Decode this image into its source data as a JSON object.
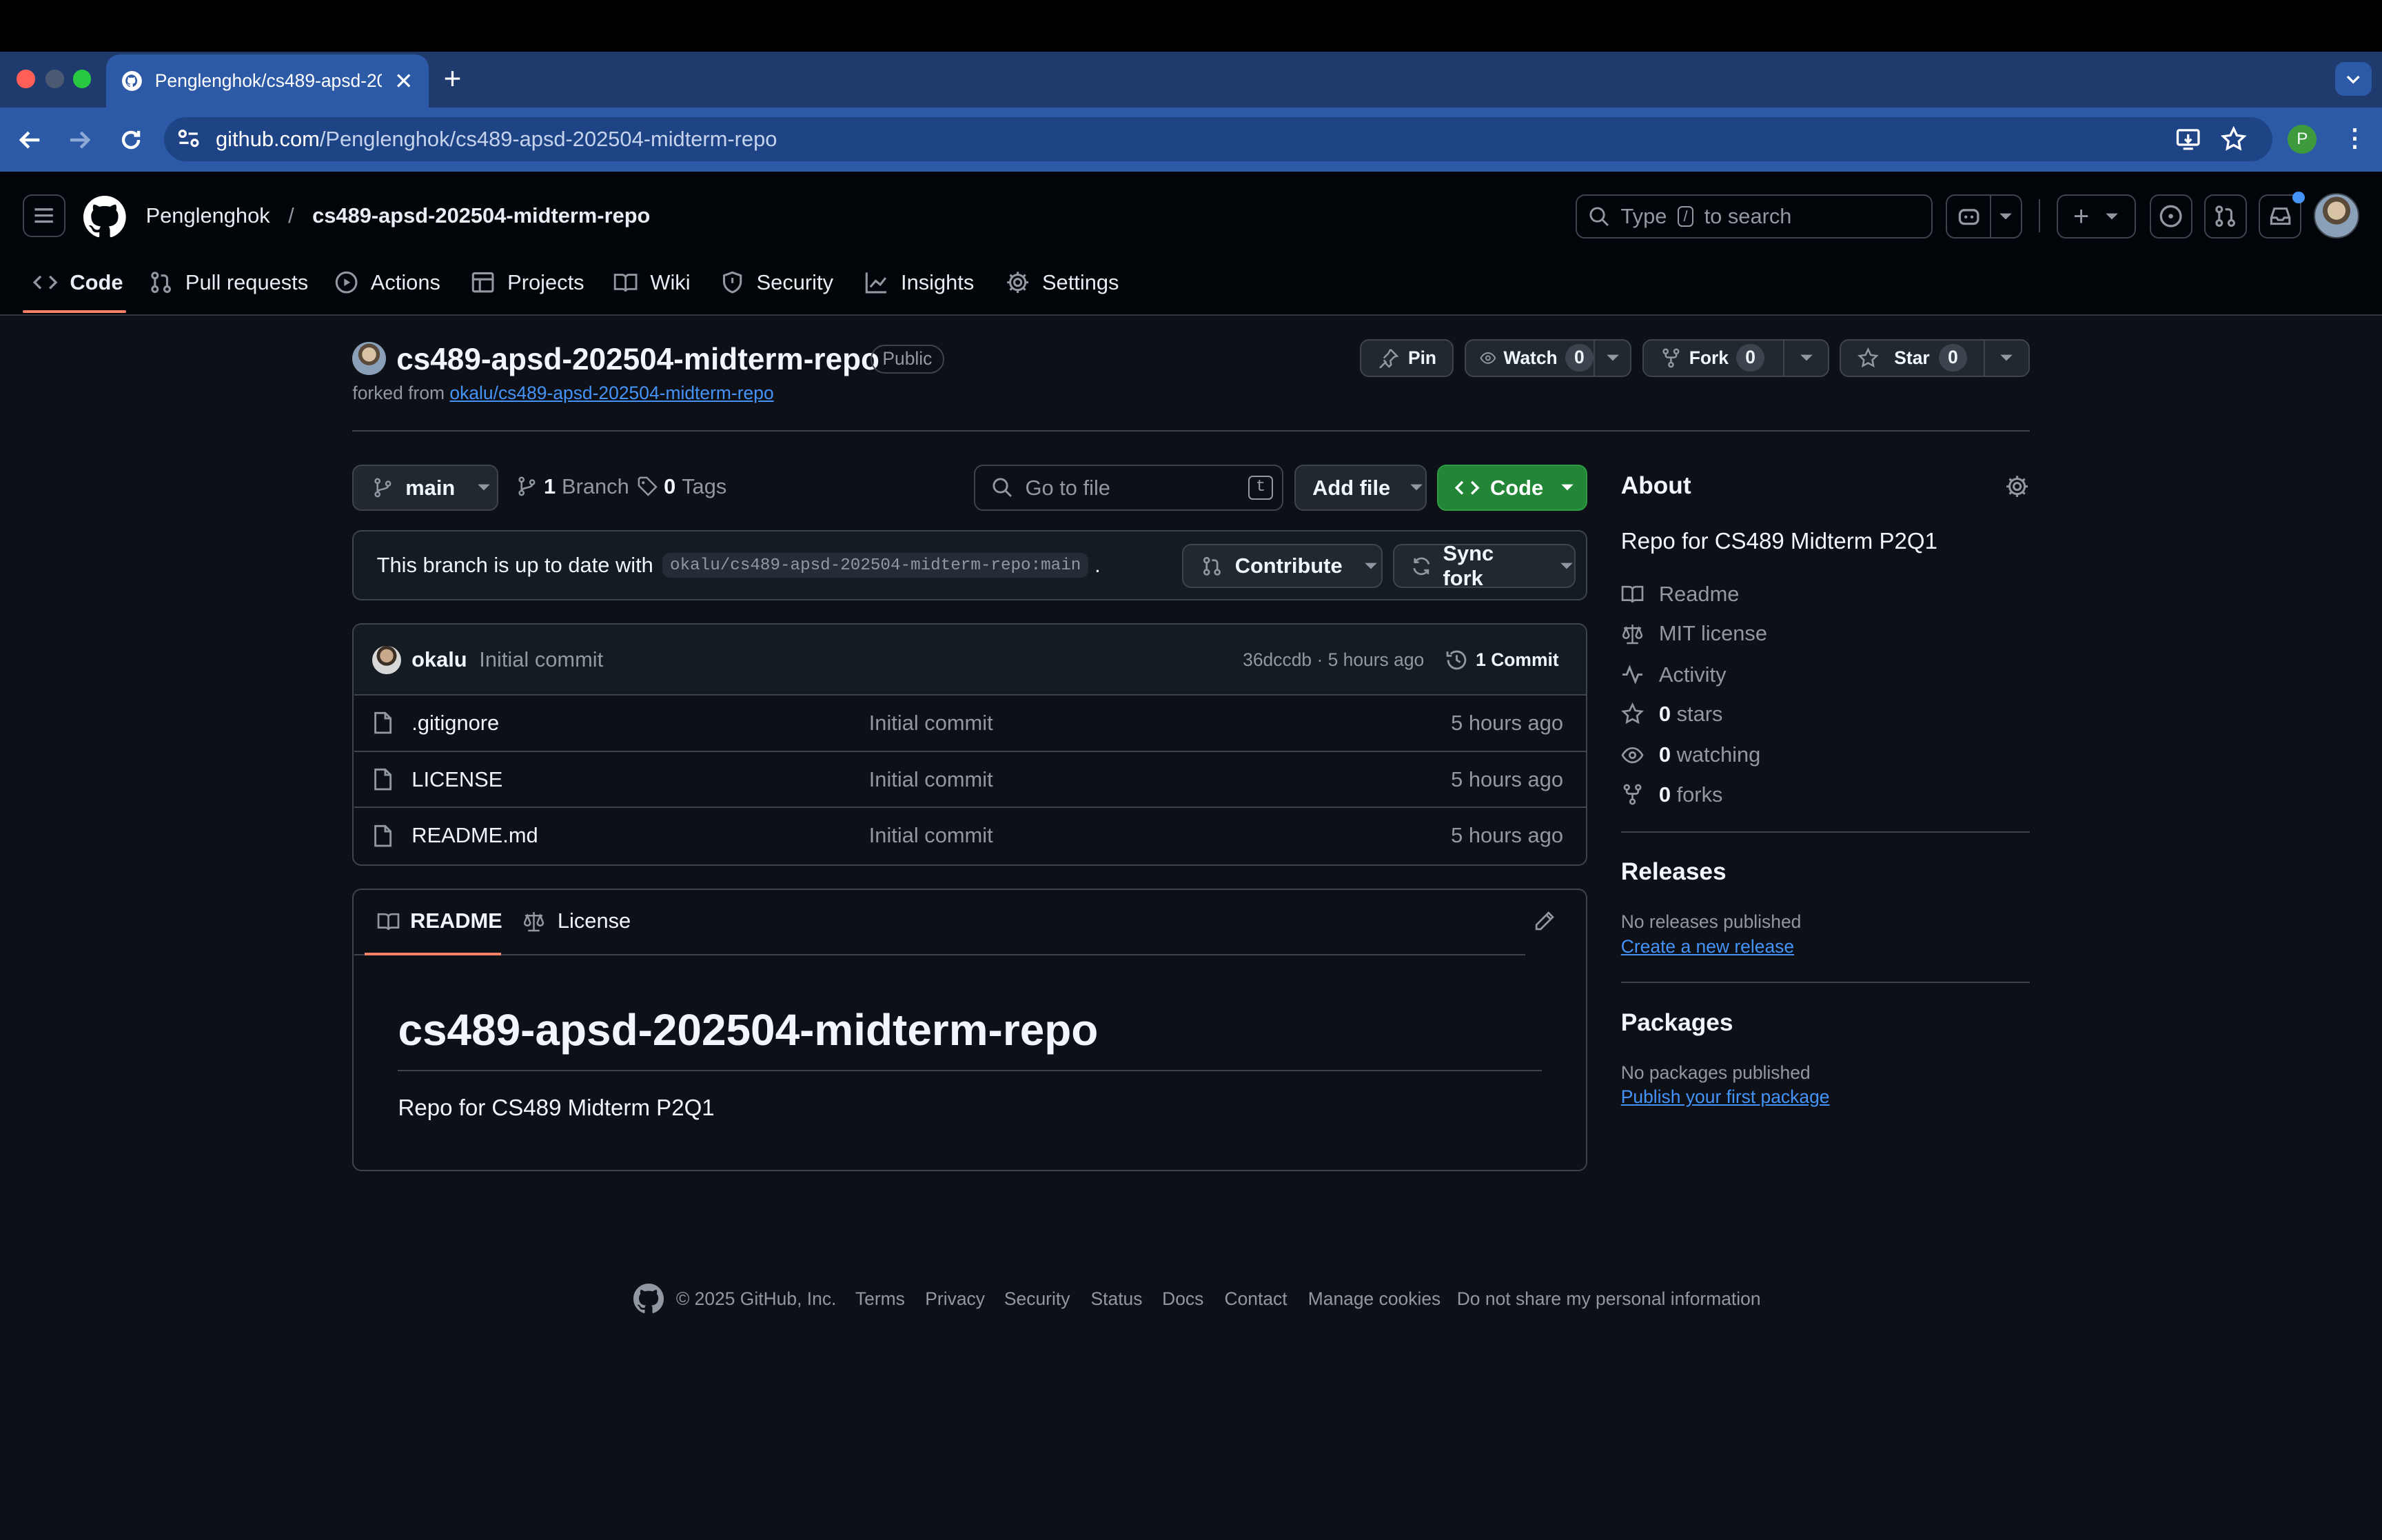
{
  "browser": {
    "tab_title": "Penglenghok/cs489-apsd-20",
    "url_host": "github.com",
    "url_path": "/Penglenghok/cs489-apsd-202504-midterm-repo",
    "profile_initial": "P"
  },
  "header": {
    "owner": "Penglenghok",
    "separator": "/",
    "repo": "cs489-apsd-202504-midterm-repo",
    "search_prefix": "Type",
    "search_key": "/",
    "search_suffix": "to search"
  },
  "repo_nav": [
    {
      "label": "Code",
      "icon": "code-icon"
    },
    {
      "label": "Pull requests",
      "icon": "pull-request-icon"
    },
    {
      "label": "Actions",
      "icon": "play-icon"
    },
    {
      "label": "Projects",
      "icon": "table-icon"
    },
    {
      "label": "Wiki",
      "icon": "book-icon"
    },
    {
      "label": "Security",
      "icon": "shield-icon"
    },
    {
      "label": "Insights",
      "icon": "graph-icon"
    },
    {
      "label": "Settings",
      "icon": "gear-icon"
    }
  ],
  "repo": {
    "name": "cs489-apsd-202504-midterm-repo",
    "visibility": "Public",
    "forked_from_label": "forked from",
    "forked_from": "okalu/cs489-apsd-202504-midterm-repo",
    "pin": "Pin",
    "watch": "Watch",
    "watch_count": "0",
    "fork": "Fork",
    "fork_count": "0",
    "star": "Star",
    "star_count": "0"
  },
  "toolbar": {
    "branch": "main",
    "branches_count": "1",
    "branches_label": "Branch",
    "tags_count": "0",
    "tags_label": "Tags",
    "goto_placeholder": "Go to file",
    "goto_key": "t",
    "add_file": "Add file",
    "code": "Code"
  },
  "sync": {
    "message": "This branch is up to date with",
    "ref": "okalu/cs489-apsd-202504-midterm-repo:main",
    "period": ".",
    "contribute": "Contribute",
    "sync_fork": "Sync fork"
  },
  "commit": {
    "author": "okalu",
    "message": "Initial commit",
    "hash_time": "36dccdb · 5 hours ago",
    "commits": "1 Commit"
  },
  "files": [
    {
      "name": ".gitignore",
      "message": "Initial commit",
      "time": "5 hours ago"
    },
    {
      "name": "LICENSE",
      "message": "Initial commit",
      "time": "5 hours ago"
    },
    {
      "name": "README.md",
      "message": "Initial commit",
      "time": "5 hours ago"
    }
  ],
  "readme": {
    "tab_readme": "README",
    "tab_license": "License",
    "heading": "cs489-apsd-202504-midterm-repo",
    "body": "Repo for CS489 Midterm P2Q1"
  },
  "about": {
    "title": "About",
    "description": "Repo for CS489 Midterm P2Q1",
    "readme": "Readme",
    "license": "MIT license",
    "activity": "Activity",
    "stars_count": "0",
    "stars": "stars",
    "watching_count": "0",
    "watching": "watching",
    "forks_count": "0",
    "forks": "forks"
  },
  "releases": {
    "title": "Releases",
    "empty": "No releases published",
    "create": "Create a new release"
  },
  "packages": {
    "title": "Packages",
    "empty": "No packages published",
    "publish": "Publish your first package"
  },
  "footer": {
    "copyright": "© 2025 GitHub, Inc.",
    "links": [
      "Terms",
      "Privacy",
      "Security",
      "Status",
      "Docs",
      "Contact",
      "Manage cookies",
      "Do not share my personal information"
    ]
  },
  "colors": {
    "accent_underline": "#f78166",
    "code_button": "#238636",
    "link": "#4493f8",
    "tab_blue": "#2d5aa6"
  }
}
